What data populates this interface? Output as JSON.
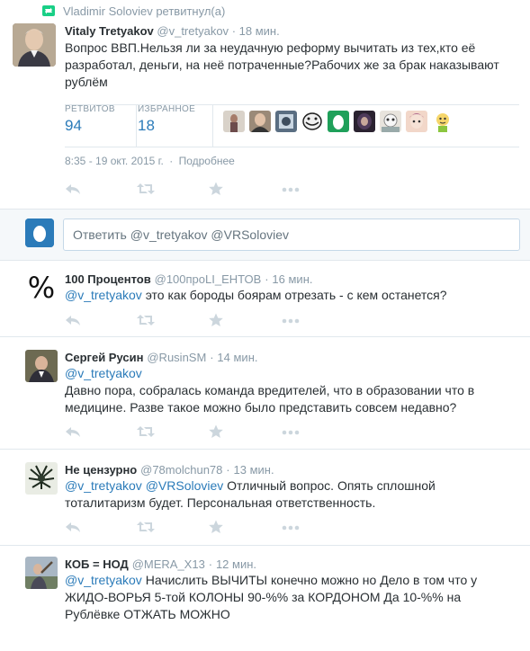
{
  "retweet_notice": {
    "text": "Vladimir Soloviev ретвитнул(а)"
  },
  "main_tweet": {
    "name": "Vitaly Tretyakov",
    "handle": "@v_tretyakov",
    "time": "18 мин.",
    "text": "Вопрос ВВП.Нельзя ли за неудачную реформу вычитать из тех,кто её разработал, деньги, на неё потраченные?Рабочих же за брак наказывают рублём",
    "retweets_label": "РЕТВИТОВ",
    "retweets_count": "94",
    "favorites_label": "ИЗБРАННОЕ",
    "favorites_count": "18",
    "timestamp": "8:35 - 19 окт. 2015 г.",
    "details_link": "Подробнее"
  },
  "reply_box": {
    "placeholder": "Ответить @v_tretyakov @VRSoloviev"
  },
  "replies": [
    {
      "name": "100 Процентов",
      "handle": "@100проLI_ЕНТОВ",
      "time": "16 мин.",
      "mention": "@v_tretyakov",
      "text": " это как бороды боярам отрезать - с кем останется?"
    },
    {
      "name": "Сергей Русин",
      "handle": "@RusinSM",
      "time": "14 мин.",
      "mention": "@v_tretyakov",
      "text": "Давно пора, собралась команда вредителей, что в образовании что в медицине. Разве такое можно было представить совсем недавно?"
    },
    {
      "name": "Не цензурно",
      "handle": "@78molchun78",
      "time": "13 мин.",
      "mention": "@v_tretyakov",
      "mention2": "@VRSoloviev",
      "text": "  Отличный вопрос. Опять сплошной тоталитаризм будет.  Персональная ответственность."
    },
    {
      "name": "КОБ = НОД",
      "handle": "@MERA_X13",
      "time": "12 мин.",
      "mention": "@v_tretyakov",
      "text": " Начислить ВЫЧИТЫ конечно можно но Дело в том что у ЖИДО-ВОРЬЯ 5-той КОЛОНЫ 90-%% за КОРДОНОМ Да 10-%% на Рублёвке ОТЖАТЬ МОЖНО"
    }
  ],
  "separator": "·",
  "icons": [
    "retweet-icon",
    "reply-icon",
    "favorite-star-icon",
    "more-dots-icon",
    "egg-avatar-icon",
    "percent-icon"
  ],
  "colors": {
    "link": "#2b7bb9",
    "muted": "#8899a6",
    "text": "#292f33",
    "retweet_green": "#19cf86",
    "divider": "#e1e8ed"
  }
}
